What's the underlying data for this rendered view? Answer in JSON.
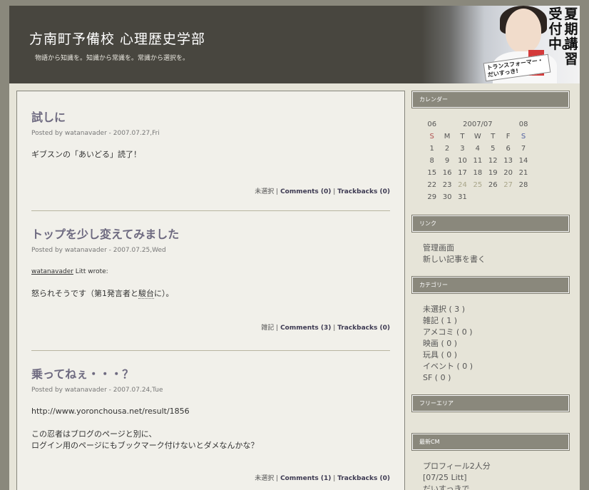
{
  "site": {
    "title": "方南町予備校 心理歴史学部",
    "description": "物語から知識を。知識から常識を。常識から選択を。"
  },
  "banner": {
    "vertical_text_1": "夏期講習",
    "vertical_text_2": "受付中。",
    "sign_text": "トランスフォーマー・だいすっき!"
  },
  "posts": [
    {
      "title": "試しに",
      "meta": "Posted by watanavader - 2007.07.27,Fri",
      "body": [
        "ギブスンの「あいどる」読了！"
      ],
      "category": "未選択",
      "comments": "Comments (0)",
      "trackbacks": "Trackbacks (0)"
    },
    {
      "title": "トップを少し変えてみました",
      "meta": "Posted by watanavader - 2007.07.25,Wed",
      "quote_user": "watanavader",
      "quote_suffix": " Litt wrote:",
      "body_prefix": "怒られそうです（第1発言者と",
      "body_link": "駿台",
      "body_suffix": "に）。",
      "category": "雑記",
      "comments": "Comments (3)",
      "trackbacks": "Trackbacks (0)"
    },
    {
      "title": "乗ってねぇ・・・？",
      "meta": "Posted by watanavader - 2007.07.24,Tue",
      "url": "http://www.yoronchousa.net/result/1856",
      "body": [
        "この忍者はブログのページと別に、",
        "ログイン用のページにもブックマーク付けないとダメなんかな？"
      ],
      "category": "未選択",
      "comments": "Comments (1)",
      "trackbacks": "Trackbacks (0)"
    }
  ],
  "sidebar": {
    "calendar": {
      "heading": "カレンダー",
      "prev": "06",
      "current": "2007/07",
      "next": "08",
      "weekdays": [
        "S",
        "M",
        "T",
        "W",
        "T",
        "F",
        "S"
      ],
      "weeks": [
        [
          "1",
          "2",
          "3",
          "4",
          "5",
          "6",
          "7"
        ],
        [
          "8",
          "9",
          "10",
          "11",
          "12",
          "13",
          "14"
        ],
        [
          "15",
          "16",
          "17",
          "18",
          "19",
          "20",
          "21"
        ],
        [
          "22",
          "23",
          "24",
          "25",
          "26",
          "27",
          "28"
        ],
        [
          "29",
          "30",
          "31",
          "",
          "",
          "",
          ""
        ]
      ],
      "post_days": [
        "24",
        "25",
        "27"
      ],
      "colors": {
        "sunday": "#b05050",
        "saturday": "#5060a0",
        "post_day": "#a9a68a"
      }
    },
    "links": {
      "heading": "リンク",
      "items": [
        "管理画面",
        "新しい記事を書く"
      ]
    },
    "categories": {
      "heading": "カテゴリー",
      "items": [
        "未選択 ( 3 )",
        "雑記 ( 1 )",
        "アメコミ ( 0 )",
        "映画 ( 0 )",
        "玩具 ( 0 )",
        "イベント ( 0 )",
        "SF ( 0 )"
      ]
    },
    "free_area": {
      "heading": "フリーエリア"
    },
    "recent_comments": {
      "heading": "最新CM",
      "items": [
        "プロフィール2人分",
        "[07/25 Litt]",
        "だいすっきで"
      ]
    }
  }
}
